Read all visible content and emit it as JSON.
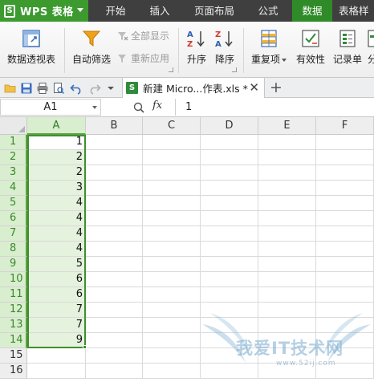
{
  "app": {
    "title": "WPS 表格",
    "logo": "S"
  },
  "menu": {
    "tabs": [
      {
        "label": "开始"
      },
      {
        "label": "插入"
      },
      {
        "label": "页面布局"
      },
      {
        "label": "公式"
      },
      {
        "label": "数据"
      },
      {
        "label": "表格样"
      }
    ],
    "active_tab": "数据"
  },
  "ribbon": {
    "pivot_label": "数据透视表",
    "autofilter_label": "自动筛选",
    "show_all_label": "全部显示",
    "reapply_label": "重新应用",
    "sort_asc_label": "升序",
    "sort_desc_label": "降序",
    "duplicates_label": "重复项",
    "validation_label": "有效性",
    "form_label": "记录单",
    "split_label": "分"
  },
  "document": {
    "tab_title": "新建 Micro...作表.xls *",
    "icon_letter": "S"
  },
  "formula_bar": {
    "name_box": "A1",
    "fx_label": "fx",
    "content": "1"
  },
  "sheet": {
    "columns": [
      "A",
      "B",
      "C",
      "D",
      "E",
      "F"
    ],
    "selected_column": "A",
    "rows": [
      {
        "row": "1",
        "A": "1"
      },
      {
        "row": "2",
        "A": "2"
      },
      {
        "row": "3",
        "A": "2"
      },
      {
        "row": "4",
        "A": "3"
      },
      {
        "row": "5",
        "A": "4"
      },
      {
        "row": "6",
        "A": "4"
      },
      {
        "row": "7",
        "A": "4"
      },
      {
        "row": "8",
        "A": "4"
      },
      {
        "row": "9",
        "A": "5"
      },
      {
        "row": "10",
        "A": "6"
      },
      {
        "row": "11",
        "A": "6"
      },
      {
        "row": "12",
        "A": "7"
      },
      {
        "row": "13",
        "A": "7"
      },
      {
        "row": "14",
        "A": "9"
      },
      {
        "row": "15",
        "A": ""
      },
      {
        "row": "16",
        "A": ""
      }
    ],
    "selection": "A1:A14"
  },
  "watermark": {
    "text": "我爱IT技术网",
    "sub": "www.52ij.com"
  },
  "colors": {
    "accent": "#3c9a2f",
    "menubar": "#3f3f3f",
    "selection_fill": "#e5f2dd",
    "selection_border": "#3f8f2f"
  }
}
